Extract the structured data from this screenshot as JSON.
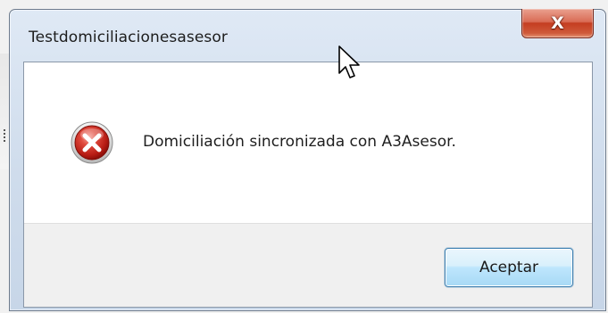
{
  "window": {
    "title": "Testdomiciliacionesasesor",
    "close_symbol": "X",
    "close_icon": "close-icon"
  },
  "message": {
    "icon": "error-icon",
    "icon_color": "#c8281e",
    "text": "Domiciliación sincronizada con A3Asesor."
  },
  "buttons": {
    "accept_label": "Aceptar",
    "accept_border_color": "#3c7fb1"
  },
  "cursor": {
    "icon": "mouse-pointer-icon"
  }
}
